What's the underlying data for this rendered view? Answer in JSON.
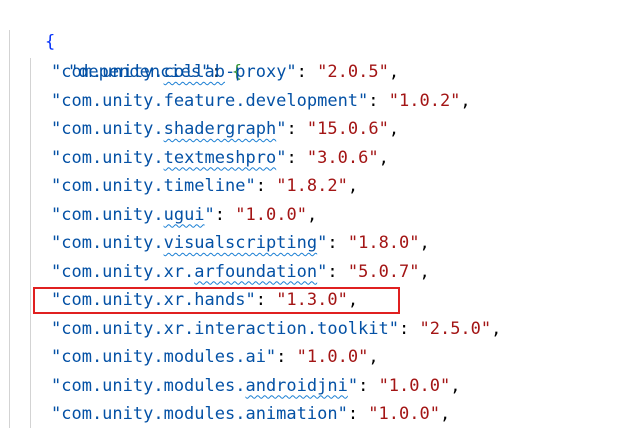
{
  "editor": {
    "open_brace": "{",
    "dependencies_key": "\"dependencies\"",
    "colon_brace": ": ",
    "inner_open_brace": "{",
    "entries": [
      {
        "prefix": "\"com.unity.",
        "squiggle": "collab",
        "rest": "-proxy\"",
        "value": "\"2.0.5\""
      },
      {
        "prefix": "\"com.unity.feature.development\"",
        "squiggle": "",
        "rest": "",
        "value": "\"1.0.2\""
      },
      {
        "prefix": "\"com.unity.",
        "squiggle": "shadergraph",
        "rest": "\"",
        "value": "\"15.0.6\""
      },
      {
        "prefix": "\"com.unity.",
        "squiggle": "textmeshpro",
        "rest": "\"",
        "value": "\"3.0.6\""
      },
      {
        "prefix": "\"com.unity.timeline\"",
        "squiggle": "",
        "rest": "",
        "value": "\"1.8.2\""
      },
      {
        "prefix": "\"com.unity.",
        "squiggle": "ugui",
        "rest": "\"",
        "value": "\"1.0.0\""
      },
      {
        "prefix": "\"com.unity.",
        "squiggle": "visualscripting",
        "rest": "\"",
        "value": "\"1.8.0\""
      },
      {
        "prefix": "\"com.unity.xr.",
        "squiggle": "arfoundation",
        "rest": "\"",
        "value": "\"5.0.7\""
      },
      {
        "prefix": "\"com.unity.xr.hands\"",
        "squiggle": "",
        "rest": "",
        "value": "\"1.3.0\""
      },
      {
        "prefix": "\"com.unity.xr.interaction.toolkit\"",
        "squiggle": "",
        "rest": "",
        "value": "\"2.5.0\""
      },
      {
        "prefix": "\"com.unity.modules.ai\"",
        "squiggle": "",
        "rest": "",
        "value": "\"1.0.0\""
      },
      {
        "prefix": "\"com.unity.modules.",
        "squiggle": "androidjni",
        "rest": "\"",
        "value": "\"1.0.0\""
      },
      {
        "prefix": "\"com.unity.modules.animation\"",
        "squiggle": "",
        "rest": "",
        "value": "\"1.0.0\""
      }
    ],
    "highlighted_entry_index": 8
  },
  "colors": {
    "key": "#0451a5",
    "value": "#a31515",
    "brace_outer": "#0431fa",
    "brace_inner": "#319331",
    "highlight_border": "#e02020",
    "squiggle": "#1a7fd4"
  }
}
